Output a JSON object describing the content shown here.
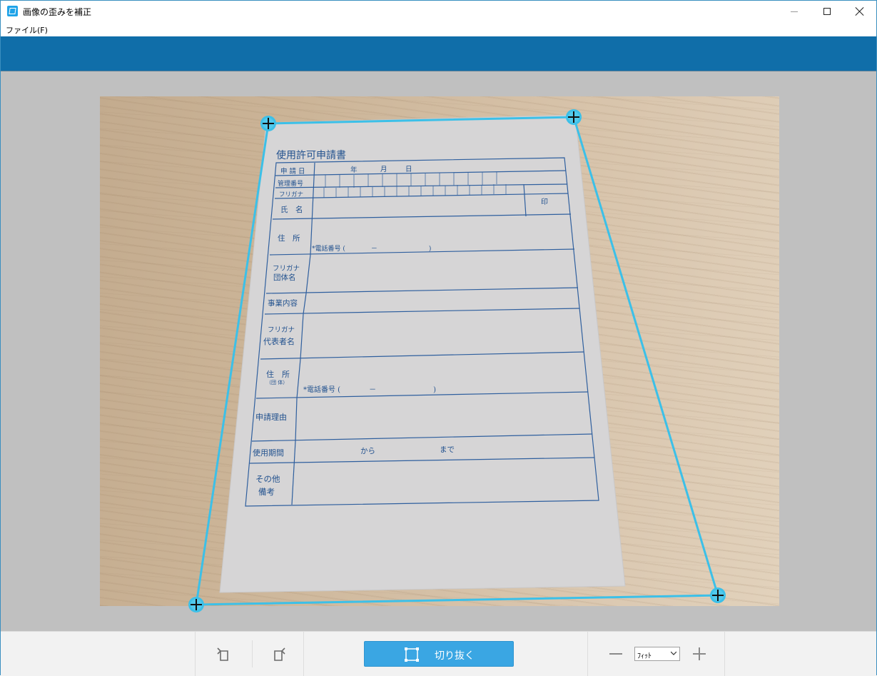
{
  "window": {
    "title": "画像の歪みを補正",
    "menu": [
      "ファイル(F)"
    ]
  },
  "document": {
    "title": "使用許可申請書",
    "rows": {
      "date_label": "申 請 日",
      "year": "年",
      "month": "月",
      "day": "日",
      "management_no": "管理番号",
      "furigana": "フリガナ",
      "seal": "印",
      "name": "氏　名",
      "address": "住　所",
      "phone": "*電話番号 (　　　　－　　　　　　　　)",
      "org_furigana": "フリガナ",
      "org_name": "団体名",
      "business": "事業内容",
      "rep_furigana": "フリガナ",
      "rep_name": "代表者名",
      "org_address": "住　所",
      "org_address_note": "（団 体）",
      "org_phone": "*電話番号 (　　　　－　　　　　　　　)",
      "reason": "申請理由",
      "period": "使用期間",
      "period_from": "から",
      "period_to": "まで",
      "other": "その他",
      "remarks": "備考"
    }
  },
  "toolbar": {
    "rotate_left": "rotate-left",
    "rotate_right": "rotate-right",
    "crop_label": "切り抜く",
    "zoom_value": "ﾌｨｯﾄ"
  },
  "colors": {
    "accent_blue": "#106ea9",
    "crop_button": "#3aa6e3",
    "handle": "#3cc0e8",
    "form_ink": "#23528f"
  }
}
